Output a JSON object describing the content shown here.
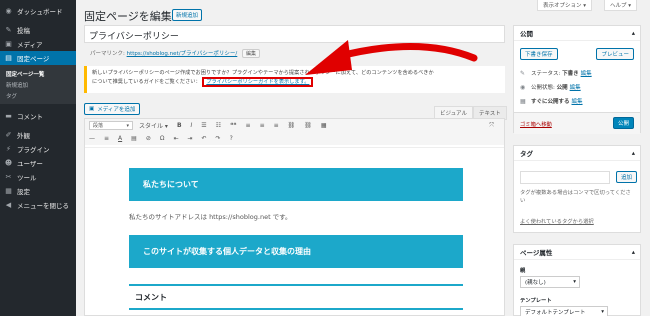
{
  "sidebar": {
    "items": [
      {
        "label": "ダッシュボード",
        "icon": "dashboard-icon",
        "glyph": "◉"
      },
      {
        "label": "投稿",
        "icon": "pin-icon",
        "glyph": "✎"
      },
      {
        "label": "メディア",
        "icon": "media-icon",
        "glyph": "▣"
      },
      {
        "label": "固定ページ",
        "icon": "page-icon",
        "glyph": "▤"
      },
      {
        "label": "コメント",
        "icon": "comment-icon",
        "glyph": "▬"
      },
      {
        "label": "外観",
        "icon": "brush-icon",
        "glyph": "✐"
      },
      {
        "label": "プラグイン",
        "icon": "plugin-icon",
        "glyph": "⚡"
      },
      {
        "label": "ユーザー",
        "icon": "user-icon",
        "glyph": "☻"
      },
      {
        "label": "ツール",
        "icon": "wrench-icon",
        "glyph": "✂"
      },
      {
        "label": "設定",
        "icon": "settings-icon",
        "glyph": "▦"
      },
      {
        "label": "メニューを閉じる",
        "icon": "collapse-icon",
        "glyph": "◀"
      }
    ],
    "submenu": [
      "固定ページ一覧",
      "新規追加",
      "タグ"
    ]
  },
  "screen_options": "表示オプション ▾",
  "help": "ヘルプ ▾",
  "page_title": "固定ページを編集",
  "add_new": "新規追加",
  "post_title": "プライバシーポリシー",
  "permalink": {
    "label": "パーマリンク:",
    "url": "https://shoblog.net/プライバシーポリシー/",
    "edit": "編集"
  },
  "notice": {
    "text": "新しいプライバシーポリシーのページ作成でお困りですか？プラグインやテーマから提案されたポリシーに加えて、どのコンテンツを含めるべきか",
    "text2": "について推奨しているガイドをご覧ください：",
    "guide": "プライバシーポリシーガイドを表示します。"
  },
  "media_button": "メディアを追加",
  "tabs": {
    "visual": "ビジュアル",
    "text": "テキスト"
  },
  "toolbar": {
    "format": "段落",
    "style": "スタイル",
    "row1": [
      "B",
      "I",
      "☰",
      "☷",
      "❝❝",
      "≡",
      "≡",
      "≡",
      "⛓",
      "⛓",
      "▦"
    ],
    "row2": [
      "—",
      "≡",
      "A",
      "▤",
      "⊘",
      "Ω",
      "⇤",
      "⇥",
      "↶",
      "↷",
      "?"
    ]
  },
  "content": {
    "h1": "私たちについて",
    "p1": "私たちのサイトアドレスは https://shoblog.net です。",
    "h2": "このサイトが収集する個人データと収集の理由",
    "h3": "コメント"
  },
  "publish": {
    "title": "公開",
    "save_draft": "下書き保存",
    "preview": "プレビュー",
    "status_label": "ステータス:",
    "status_value": "下書き",
    "visibility_label": "公開状態:",
    "visibility_value": "公開",
    "schedule": "すぐに公開する",
    "edit": "編集",
    "trash": "ゴミ箱へ移動",
    "publish_btn": "公開"
  },
  "tags": {
    "title": "タグ",
    "add": "追加",
    "hint": "タグが複数ある場合はコンマで区切ってください",
    "popular": "よく使われているタグから選択"
  },
  "attributes": {
    "title": "ページ属性",
    "parent_label": "親",
    "parent_value": "(親なし)",
    "template_label": "テンプレート",
    "template_value": "デフォルトテンプレート"
  },
  "colors": {
    "accent": "#0073aa",
    "block": "#1ca8ca",
    "arrow": "#e00000"
  }
}
